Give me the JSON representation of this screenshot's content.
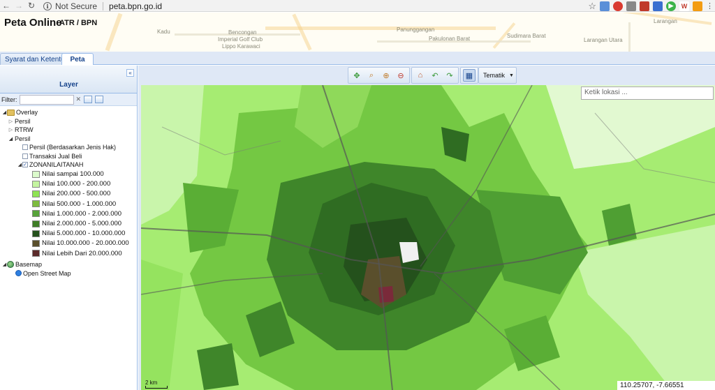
{
  "browser": {
    "security_label": "Not Secure",
    "url": "peta.bpn.go.id"
  },
  "app": {
    "title": "Peta Online",
    "subtitle": "ATR / BPN",
    "header_places": [
      "Kadu",
      "Bencongan",
      "Imperial Golf Club",
      "Lippo Karawaci",
      "Panunggangan",
      "Pakulonan Barat",
      "Sudimara Barat",
      "Larangan Utara",
      "Larangan"
    ]
  },
  "tabs": [
    {
      "label": "Syarat dan Ketentuan",
      "active": false
    },
    {
      "label": "Peta",
      "active": true
    }
  ],
  "layer_panel": {
    "title": "Layer",
    "collapse_glyph": "«",
    "filter_label": "Filter:",
    "filter_value": "",
    "overlay_label": "Overlay",
    "persil_label": "Persil",
    "rtrw_label": "RTRW",
    "persil_group_label": "Persil",
    "persil_jenis_hak_label": "Persil (Berdasarkan Jenis Hak)",
    "transaksi_label": "Transaksi Jual Beli",
    "zona_label": "ZONANILAITANAH",
    "legend": [
      {
        "label": "Nilai sampai 100.000",
        "color": "#dcfbcc"
      },
      {
        "label": "Nilai 100.000 - 200.000",
        "color": "#c4f4a0"
      },
      {
        "label": "Nilai 200.000 - 500.000",
        "color": "#8fe354"
      },
      {
        "label": "Nilai 500.000 - 1.000.000",
        "color": "#7dbb3e"
      },
      {
        "label": "Nilai 1.000.000 - 2.000.000",
        "color": "#57a33a"
      },
      {
        "label": "Nilai 2.000.000 - 5.000.000",
        "color": "#3f7d26"
      },
      {
        "label": "Nilai 5.000.000 - 10.000.000",
        "color": "#24511c"
      },
      {
        "label": "Nilai 10.000.000 - 20.000.000",
        "color": "#5a4f2c"
      },
      {
        "label": "Nilai Lebih Dari 20.000.000",
        "color": "#5c2b2b"
      }
    ],
    "basemap_label": "Basemap",
    "osm_label": "Open Street Map"
  },
  "toolbar": {
    "tematik_label": "Tematik"
  },
  "map": {
    "search_placeholder": "Ketik lokasi ...",
    "scale_label": "2 km",
    "coordinates": "110.25707, -7.66551"
  },
  "colors": {
    "accent": "#15428b",
    "panel_bg": "#dfe8f6",
    "border": "#99bbe8"
  }
}
